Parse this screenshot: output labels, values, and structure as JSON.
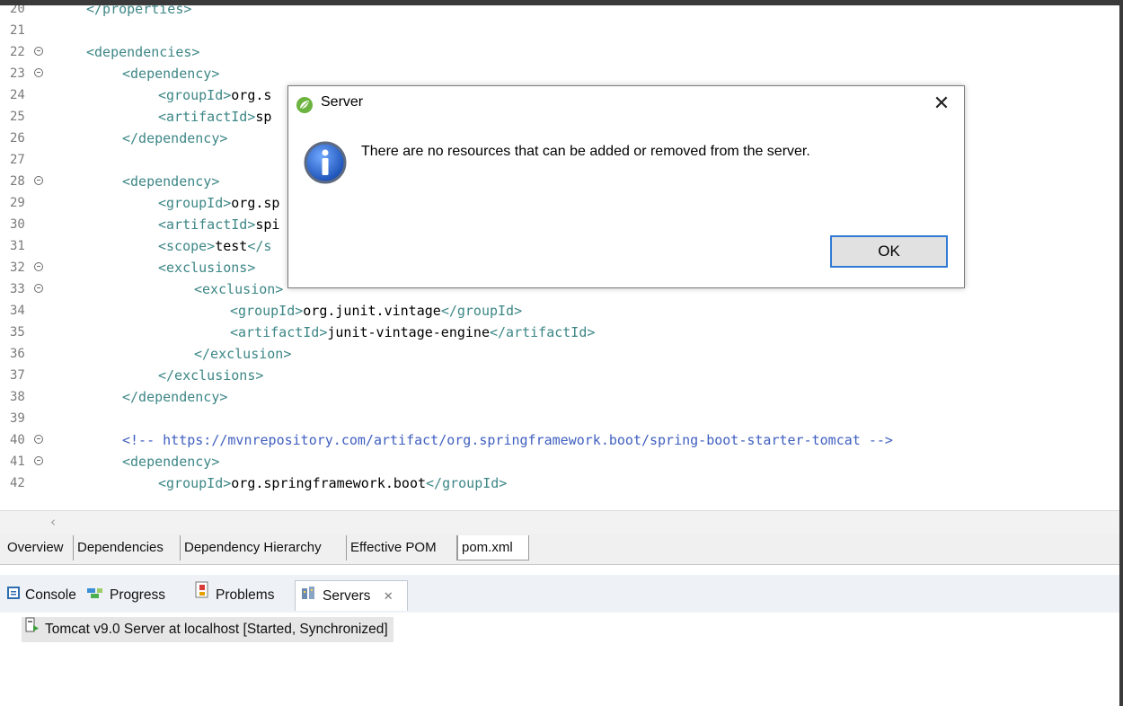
{
  "editor": {
    "lines": [
      {
        "num": "20",
        "fold": false,
        "indent": 0,
        "parts": [
          [
            "tg",
            "</properties>"
          ]
        ]
      },
      {
        "num": "21",
        "fold": false,
        "indent": 0,
        "parts": []
      },
      {
        "num": "22",
        "fold": true,
        "indent": 0,
        "parts": [
          [
            "tg",
            "<dependencies>"
          ]
        ]
      },
      {
        "num": "23",
        "fold": true,
        "indent": 1,
        "parts": [
          [
            "tg",
            "<dependency>"
          ]
        ]
      },
      {
        "num": "24",
        "fold": false,
        "indent": 2,
        "parts": [
          [
            "tg",
            "<groupId>"
          ],
          [
            "tx",
            "org.s"
          ]
        ]
      },
      {
        "num": "25",
        "fold": false,
        "indent": 2,
        "parts": [
          [
            "tg",
            "<artifactId>"
          ],
          [
            "tx",
            "sp"
          ]
        ]
      },
      {
        "num": "26",
        "fold": false,
        "indent": 1,
        "parts": [
          [
            "tg",
            "</dependency>"
          ]
        ]
      },
      {
        "num": "27",
        "fold": false,
        "indent": 0,
        "parts": []
      },
      {
        "num": "28",
        "fold": true,
        "indent": 1,
        "parts": [
          [
            "tg",
            "<dependency>"
          ]
        ]
      },
      {
        "num": "29",
        "fold": false,
        "indent": 2,
        "parts": [
          [
            "tg",
            "<groupId>"
          ],
          [
            "tx",
            "org.sp"
          ]
        ]
      },
      {
        "num": "30",
        "fold": false,
        "indent": 2,
        "parts": [
          [
            "tg",
            "<artifactId>"
          ],
          [
            "tx",
            "spi"
          ]
        ]
      },
      {
        "num": "31",
        "fold": false,
        "indent": 2,
        "parts": [
          [
            "tg",
            "<scope>"
          ],
          [
            "tx",
            "test"
          ],
          [
            "tg",
            "</s"
          ]
        ]
      },
      {
        "num": "32",
        "fold": true,
        "indent": 2,
        "parts": [
          [
            "tg",
            "<exclusions>"
          ]
        ]
      },
      {
        "num": "33",
        "fold": true,
        "indent": 3,
        "parts": [
          [
            "tg",
            "<exclusion>"
          ]
        ]
      },
      {
        "num": "34",
        "fold": false,
        "indent": 4,
        "parts": [
          [
            "tg",
            "<groupId>"
          ],
          [
            "tx",
            "org.junit.vintage"
          ],
          [
            "tg",
            "</groupId>"
          ]
        ]
      },
      {
        "num": "35",
        "fold": false,
        "indent": 4,
        "parts": [
          [
            "tg",
            "<artifactId>"
          ],
          [
            "tx",
            "junit-vintage-engine"
          ],
          [
            "tg",
            "</artifactId>"
          ]
        ]
      },
      {
        "num": "36",
        "fold": false,
        "indent": 3,
        "parts": [
          [
            "tg",
            "</exclusion>"
          ]
        ]
      },
      {
        "num": "37",
        "fold": false,
        "indent": 2,
        "parts": [
          [
            "tg",
            "</exclusions>"
          ]
        ]
      },
      {
        "num": "38",
        "fold": false,
        "indent": 1,
        "parts": [
          [
            "tg",
            "</dependency>"
          ]
        ]
      },
      {
        "num": "39",
        "fold": false,
        "indent": 0,
        "parts": []
      },
      {
        "num": "40",
        "fold": true,
        "indent": 1,
        "parts": [
          [
            "cm",
            "<!-- https://mvnrepository.com/artifact/org.springframework.boot/spring-boot-starter-tomcat -->"
          ]
        ]
      },
      {
        "num": "41",
        "fold": true,
        "indent": 1,
        "parts": [
          [
            "tg",
            "<dependency>"
          ]
        ]
      },
      {
        "num": "42",
        "fold": false,
        "indent": 2,
        "parts": [
          [
            "tg",
            "<groupId>"
          ],
          [
            "tx",
            "org.springframework.boot"
          ],
          [
            "tg",
            "</groupId>"
          ]
        ]
      }
    ]
  },
  "editor_tabs": [
    "Overview",
    "Dependencies",
    "Dependency Hierarchy",
    "Effective POM",
    "pom.xml"
  ],
  "editor_tabs_active": "pom.xml",
  "views": {
    "tabs": [
      {
        "label": "Console",
        "icon": "console-icon"
      },
      {
        "label": "Progress",
        "icon": "progress-icon"
      },
      {
        "label": "Problems",
        "icon": "problems-icon"
      },
      {
        "label": "Servers",
        "icon": "servers-icon"
      }
    ],
    "active": "Servers"
  },
  "servers": {
    "rows": [
      "Tomcat v9.0 Server at localhost  [Started, Synchronized]"
    ]
  },
  "dialog": {
    "title": "Server",
    "message": "There are no resources that can be added or removed from the server.",
    "ok_label": "OK"
  }
}
